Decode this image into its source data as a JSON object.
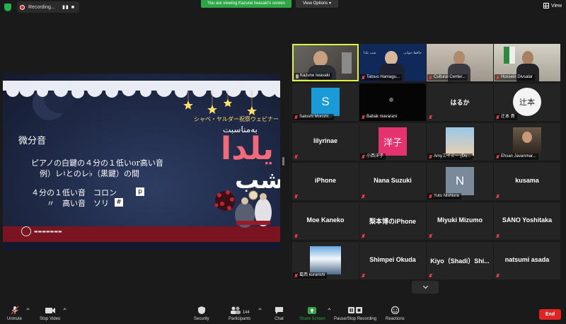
{
  "topbar": {
    "recording_label": "Recording...",
    "recording_controls": "▮▮ ■",
    "viewing_banner": "You are viewing Kazune Iwasaki's screen",
    "view_options_label": "View Options",
    "view_label": "View"
  },
  "slide": {
    "heading": "微分音",
    "line1": "ピアノの白鍵の４分の１低いor高い音",
    "line2": "例）レ♮とのレ♭（黒鍵）の間",
    "line3": "４分の１低い音　コロン",
    "line4": "〃　高い音　ソリ",
    "mark_koron": "p",
    "mark_sori": "#",
    "subtitle": "シャベ・ヤルダー祝祭ウェビナー",
    "persian_line": "به‌مناسبت",
    "title_line1": "یلدا",
    "title_line2": "شب"
  },
  "participants": [
    {
      "label": "Kazune Iwasaki",
      "big": "",
      "type": "video-man",
      "muted": false,
      "pinned": true
    },
    {
      "label": "Tatsuo Hamagu...",
      "big": "",
      "type": "video-tv",
      "muted": true
    },
    {
      "label": "Cultural Center...",
      "big": "",
      "type": "video-man2",
      "muted": true
    },
    {
      "label": "Hossein Divsalar",
      "big": "",
      "type": "video-man3",
      "muted": true
    },
    {
      "label": "Satoshi Morishi...",
      "big": "",
      "type": "avatar-s",
      "avatar": "S",
      "muted": true
    },
    {
      "label": "Babak niavarani",
      "big": "",
      "type": "video-dark",
      "muted": true
    },
    {
      "label": "",
      "big": "はるか",
      "type": "name",
      "muted": false
    },
    {
      "label": "辻本 貢",
      "big": "",
      "type": "avatar-tsuji",
      "avatar": "辻本",
      "muted": true
    },
    {
      "label": "",
      "big": "lilyrinae",
      "type": "name",
      "muted": false
    },
    {
      "label": "小西洋子",
      "big": "",
      "type": "avatar-yoko",
      "avatar": "洋子",
      "muted": true
    },
    {
      "label": "Amyエイミー (Du...",
      "big": "",
      "type": "photo-amy",
      "muted": true
    },
    {
      "label": "Ehsan Javanmar...",
      "big": "",
      "type": "photo-ehsan",
      "muted": true
    },
    {
      "label": "",
      "big": "iPhone",
      "type": "name",
      "muted": false
    },
    {
      "label": "",
      "big": "Nana Suzuki",
      "type": "name",
      "muted": false
    },
    {
      "label": "Yuto Nishiura",
      "big": "",
      "type": "avatar-n",
      "avatar": "N",
      "muted": true
    },
    {
      "label": "",
      "big": "kusama",
      "type": "name",
      "muted": false
    },
    {
      "label": "",
      "big": "Moe Kaneko",
      "type": "name",
      "muted": false
    },
    {
      "label": "",
      "big": "梨本博のiPhone",
      "type": "name",
      "muted": false
    },
    {
      "label": "",
      "big": "Miyuki Mizumo",
      "type": "name",
      "muted": false
    },
    {
      "label": "",
      "big": "SANO Yoshitaka",
      "type": "name",
      "muted": false
    },
    {
      "label": "葛西 kurarishi",
      "big": "",
      "type": "photo-mountain",
      "muted": true
    },
    {
      "label": "",
      "big": "Shimpei Okuda",
      "type": "name",
      "muted": false
    },
    {
      "label": "",
      "big": "Kiyo（Shadi）Shi...",
      "type": "name",
      "muted": false
    },
    {
      "label": "",
      "big": "natsumi asada",
      "type": "name",
      "muted": false
    }
  ],
  "toolbar": {
    "unmute": "Unmute",
    "stop_video": "Stop Video",
    "security": "Security",
    "participants": "Participants",
    "participants_count": "144",
    "chat": "Chat",
    "share_screen": "Share Screen",
    "record": "Pause/Stop Recording",
    "reactions": "Reactions",
    "end": "End"
  },
  "colors": {
    "accent_green": "#2fa646",
    "active_speaker": "#dff53c",
    "end_red": "#e02424",
    "mute_red": "#e23c3c"
  }
}
